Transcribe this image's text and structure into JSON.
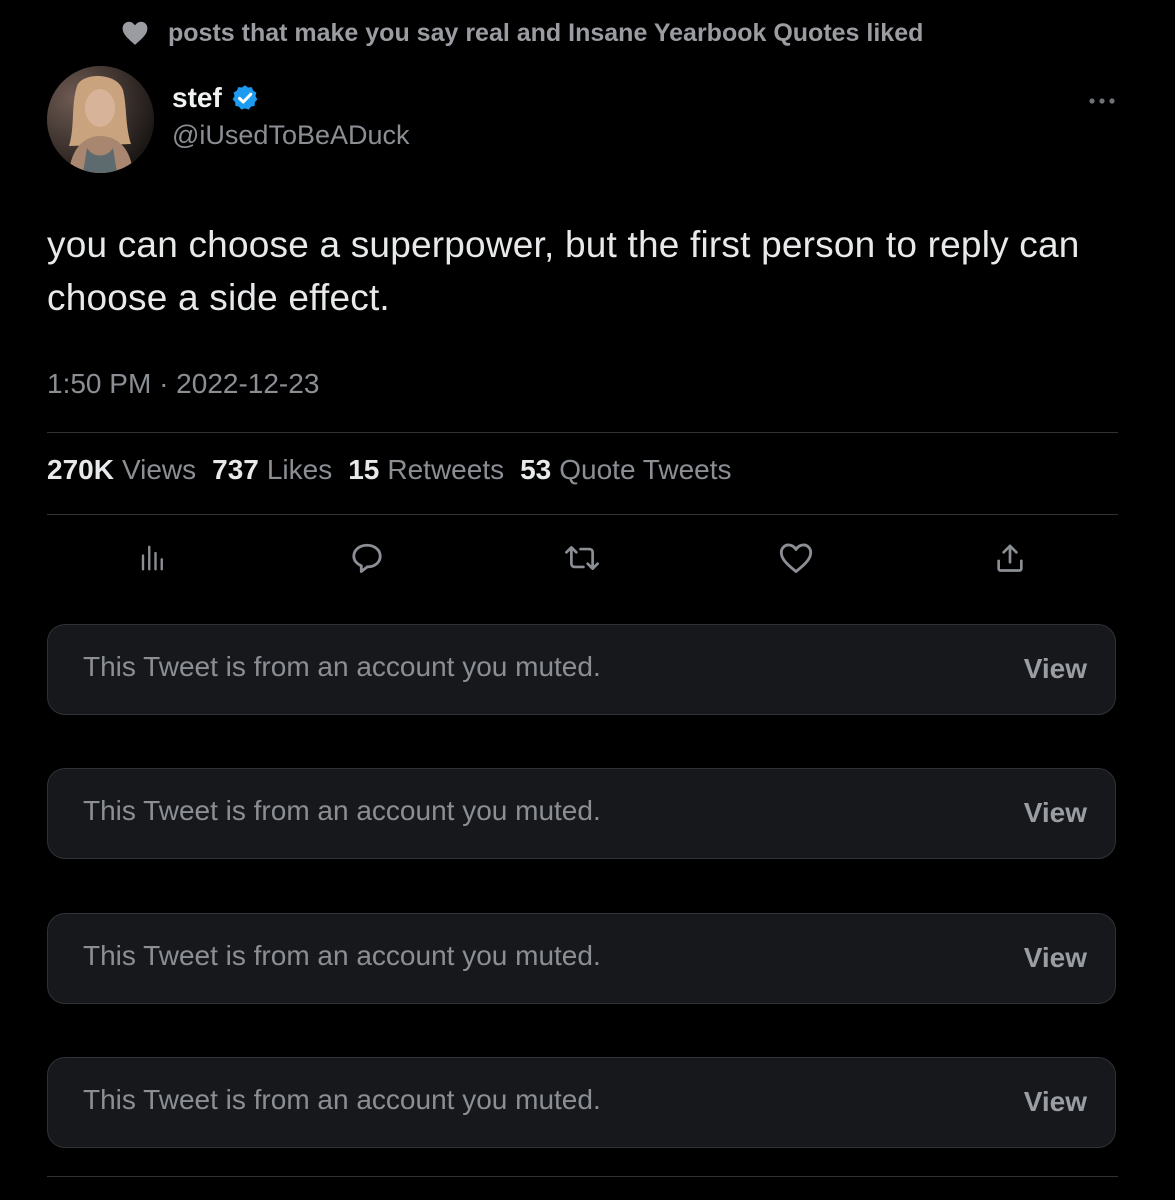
{
  "social_context": {
    "icon": "heart-icon",
    "text": "posts that make you say real and Insane Yearbook Quotes liked"
  },
  "author": {
    "display_name": "stef",
    "handle": "@iUsedToBeADuck",
    "verified_icon": "verified-badge-icon",
    "verified_color": "#1d9bf0"
  },
  "tweet": {
    "text": "you can choose a superpower, but the first person to reply can choose a side effect.",
    "time": "1:50 PM",
    "separator": "·",
    "date": "2022-12-23"
  },
  "stats": [
    {
      "value": "270K",
      "label": "Views"
    },
    {
      "value": "737",
      "label": "Likes"
    },
    {
      "value": "15",
      "label": "Retweets"
    },
    {
      "value": "53",
      "label": "Quote Tweets"
    }
  ],
  "actions": [
    {
      "name": "analytics",
      "icon": "bar-chart-icon"
    },
    {
      "name": "reply",
      "icon": "reply-bubble-icon"
    },
    {
      "name": "retweet",
      "icon": "retweet-icon"
    },
    {
      "name": "like",
      "icon": "heart-outline-icon"
    },
    {
      "name": "share",
      "icon": "share-icon"
    }
  ],
  "muted_replies": [
    {
      "text": "This Tweet is from an account you muted.",
      "action": "View"
    },
    {
      "text": "This Tweet is from an account you muted.",
      "action": "View"
    },
    {
      "text": "This Tweet is from an account you muted.",
      "action": "View"
    },
    {
      "text": "This Tweet is from an account you muted.",
      "action": "View"
    }
  ],
  "colors": {
    "background": "#000000",
    "text_primary": "#e7e9ea",
    "text_secondary": "#8b8f94",
    "divider": "#2f3336",
    "card_background": "#16181c"
  }
}
